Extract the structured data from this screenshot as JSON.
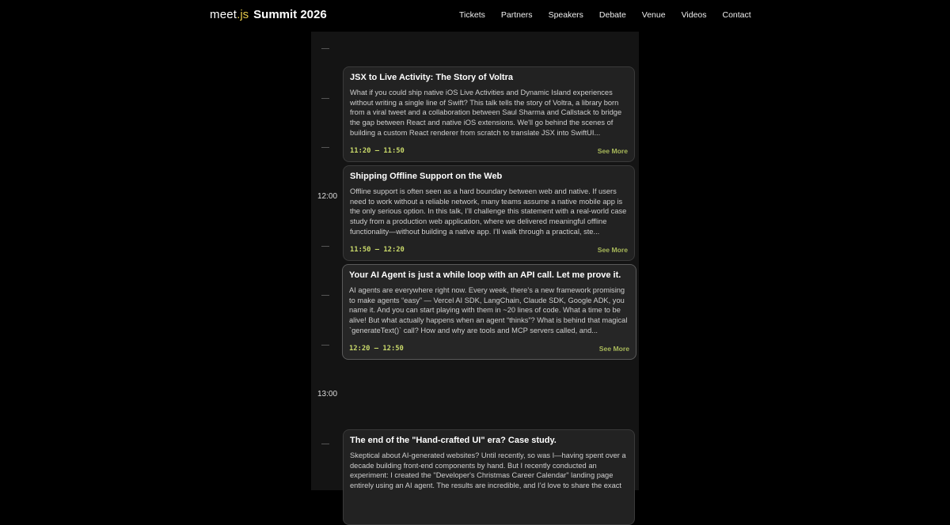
{
  "header": {
    "logo_meet": "meet",
    "logo_js": ".js",
    "logo_summit": "Summit 2026",
    "nav": [
      "Tickets",
      "Partners",
      "Speakers",
      "Debate",
      "Venue",
      "Videos",
      "Contact"
    ]
  },
  "schedule": {
    "time_labels": [
      "12:00",
      "13:00"
    ],
    "see_more_label": "See More",
    "talks": [
      {
        "title": "JSX to Live Activity: The Story of Voltra",
        "description": "What if you could ship native iOS Live Activities and Dynamic Island experiences without writing a single line of Swift? This talk tells the story of Voltra, a library born from a viral tweet and a collaboration between Saul Sharma and Callstack to bridge the gap between React and native iOS extensions. We'll go behind the scenes of building a custom React renderer from scratch to translate JSX into SwiftUI...",
        "time": "11:20 – 11:50"
      },
      {
        "title": "Shipping Offline Support on the Web",
        "description": "Offline support is often seen as a hard boundary between web and native. If users need to work without a reliable network, many teams assume a native mobile app is the only serious option. In this talk, I’ll challenge this statement with a real-world case study from a production web application, where we delivered meaningful offline functionality—without building a native app. I’ll walk through a practical, ste...",
        "time": "11:50 – 12:20"
      },
      {
        "title": "Your AI Agent is just a while loop with an API call. Let me prove it.",
        "description": "AI agents are everywhere right now. Every week, there’s a new framework promising to make agents “easy” — Vercel AI SDK, LangChain, Claude SDK, Google ADK, you name it. And you can start playing with them in ~20 lines of code. What a time to be alive! But what actually happens when an agent “thinks”? What is behind that magical `generateText()` call? How and why are tools and MCP servers called, and...",
        "time": "12:20 – 12:50"
      },
      {
        "title": "The end of the \"Hand-crafted UI\" era? Case study.",
        "description": "Skeptical about AI-generated websites? Until recently, so was I—having spent over a decade building front-end components by hand. But I recently conducted an experiment: I created the \"Developer's Christmas Career Calendar\" landing page entirely using an AI agent. The results are incredible, and I’d love to share the exact"
      }
    ]
  }
}
